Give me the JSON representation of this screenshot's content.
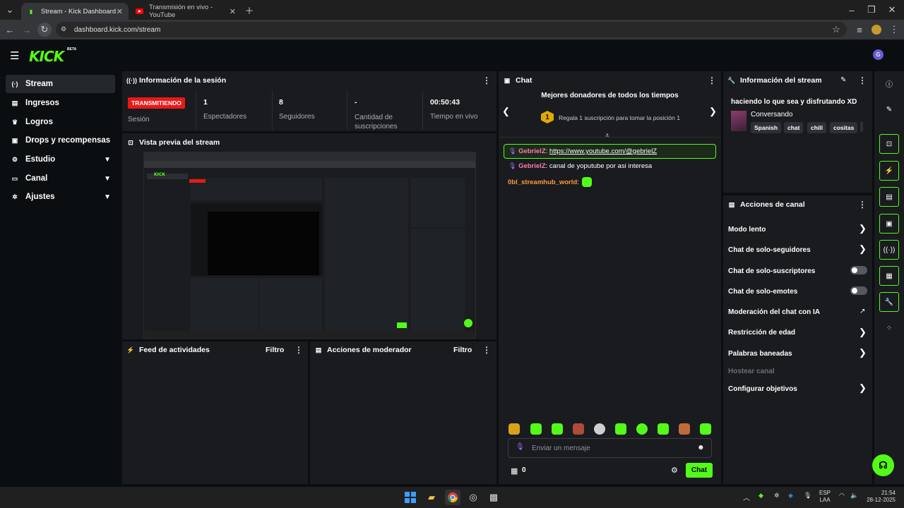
{
  "browser": {
    "tabs": [
      {
        "title": "Stream - Kick Dashboard",
        "active": true
      },
      {
        "title": "Transmisión en vivo - YouTube",
        "active": false
      }
    ],
    "url": "dashboard.kick.com/stream"
  },
  "sidebar": {
    "items": [
      {
        "label": "Stream",
        "icon": "broadcast-icon"
      },
      {
        "label": "Ingresos",
        "icon": "money-icon"
      },
      {
        "label": "Logros",
        "icon": "trophy-icon"
      },
      {
        "label": "Drops y recompensas",
        "icon": "gift-icon"
      },
      {
        "label": "Estudio",
        "icon": "studio-icon"
      },
      {
        "label": "Canal",
        "icon": "channel-icon"
      },
      {
        "label": "Ajustes",
        "icon": "gear-icon"
      }
    ]
  },
  "session": {
    "title": "Información de la sesión",
    "status_badge": "TRANSMITIENDO",
    "status_label": "Sesión",
    "stats": [
      {
        "value": "1",
        "label": "Espectadores"
      },
      {
        "value": "8",
        "label": "Seguidores"
      },
      {
        "value": "-",
        "label": "Cantidad de suscripciones"
      },
      {
        "value": "00:50:43",
        "label": "Tiempo en vivo"
      }
    ]
  },
  "preview": {
    "title": "Vista previa del stream"
  },
  "activity": {
    "title": "Feed de actividades",
    "filter": "Filtro"
  },
  "modactions": {
    "title": "Acciones de moderador",
    "filter": "Filtro"
  },
  "chat": {
    "title": "Chat",
    "donors_title": "Mejores donadores de todos los tiempos",
    "rank": "1",
    "gift_text": "Regala 1 suscripción para tomar la posición 1",
    "messages": [
      {
        "user": "GebrielZ",
        "sep": ":",
        "text": "https://www.youtube.com/@gebrielZ"
      },
      {
        "user": "GebrielZ",
        "sep": ":",
        "text": "canal de yoputube por asi interesa"
      },
      {
        "user": "0bl_streamhub_world",
        "sep": ":",
        "text": ""
      }
    ],
    "input_placeholder": "Enviar un mensaje",
    "points": "0",
    "send_label": "Chat"
  },
  "stream_info": {
    "title": "Información del stream",
    "stream_title": "haciendo lo que sea y disfrutando XD",
    "category": "Conversando",
    "tags": [
      "Spanish",
      "chat",
      "chill",
      "cositas"
    ]
  },
  "channel_actions": {
    "title": "Acciones de canal",
    "items": [
      {
        "label": "Modo lento",
        "control": "chevron"
      },
      {
        "label": "Chat de solo-seguidores",
        "control": "chevron"
      },
      {
        "label": "Chat de solo-suscriptores",
        "control": "toggle"
      },
      {
        "label": "Chat de solo-emotes",
        "control": "toggle"
      },
      {
        "label": "Moderación del chat con IA",
        "control": "external"
      },
      {
        "label": "Restricción de edad",
        "control": "chevron"
      },
      {
        "label": "Palabras baneadas",
        "control": "chevron"
      },
      {
        "label": "Hostear canal",
        "control": "none"
      },
      {
        "label": "Configurar objetivos",
        "control": "chevron"
      }
    ]
  },
  "taskbar": {
    "lang": "ESP",
    "lang2": "LAA",
    "time": "21:54",
    "date": "28-12-2025"
  },
  "colors": {
    "accent": "#53fc18",
    "live": "#e91916",
    "username": "#ff7ab2"
  }
}
